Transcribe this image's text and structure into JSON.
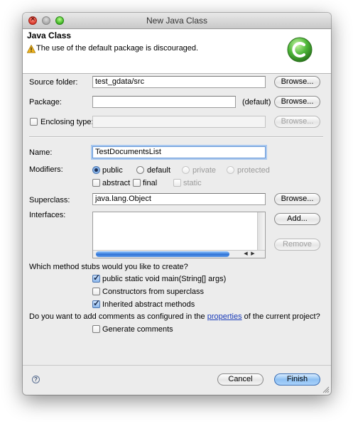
{
  "window": {
    "title": "New Java Class"
  },
  "header": {
    "title": "Java Class",
    "message": "The use of the default package is discouraged.",
    "icons": {
      "warning": "warning-icon",
      "logo": "new-class-wizard-icon"
    }
  },
  "form": {
    "source_folder": {
      "label": "Source folder:",
      "value": "test_gdata/src",
      "button": "Browse..."
    },
    "package": {
      "label": "Package:",
      "value": "",
      "default_hint": "(default)",
      "button": "Browse..."
    },
    "enclosing_type": {
      "label": "Enclosing type:",
      "checked": false,
      "value": "",
      "button": "Browse..."
    },
    "name": {
      "label": "Name:",
      "value": "TestDocumentsList"
    },
    "modifiers": {
      "label": "Modifiers:",
      "access": [
        "public",
        "default",
        "private",
        "protected"
      ],
      "selected": "public",
      "other": [
        "abstract",
        "final",
        "static"
      ]
    },
    "superclass": {
      "label": "Superclass:",
      "value": "java.lang.Object",
      "button": "Browse..."
    },
    "interfaces": {
      "label": "Interfaces:",
      "add_button": "Add...",
      "remove_button": "Remove",
      "items": []
    }
  },
  "stubs": {
    "question": "Which method stubs would you like to create?",
    "options": [
      {
        "label": "public static void main(String[] args)",
        "checked": true
      },
      {
        "label": "Constructors from superclass",
        "checked": false
      },
      {
        "label": "Inherited abstract methods",
        "checked": true
      }
    ]
  },
  "comments": {
    "question_prefix": "Do you want to add comments as configured in the ",
    "question_link": "properties",
    "question_suffix": " of the current project?",
    "option": {
      "label": "Generate comments",
      "checked": false
    }
  },
  "footer": {
    "cancel": "Cancel",
    "finish": "Finish",
    "help_icon": "help-icon"
  },
  "colors": {
    "accent": "#3b6fb6",
    "link": "#1a3bb8",
    "warning": "#f2b51c",
    "logo": "#4fb83a"
  }
}
